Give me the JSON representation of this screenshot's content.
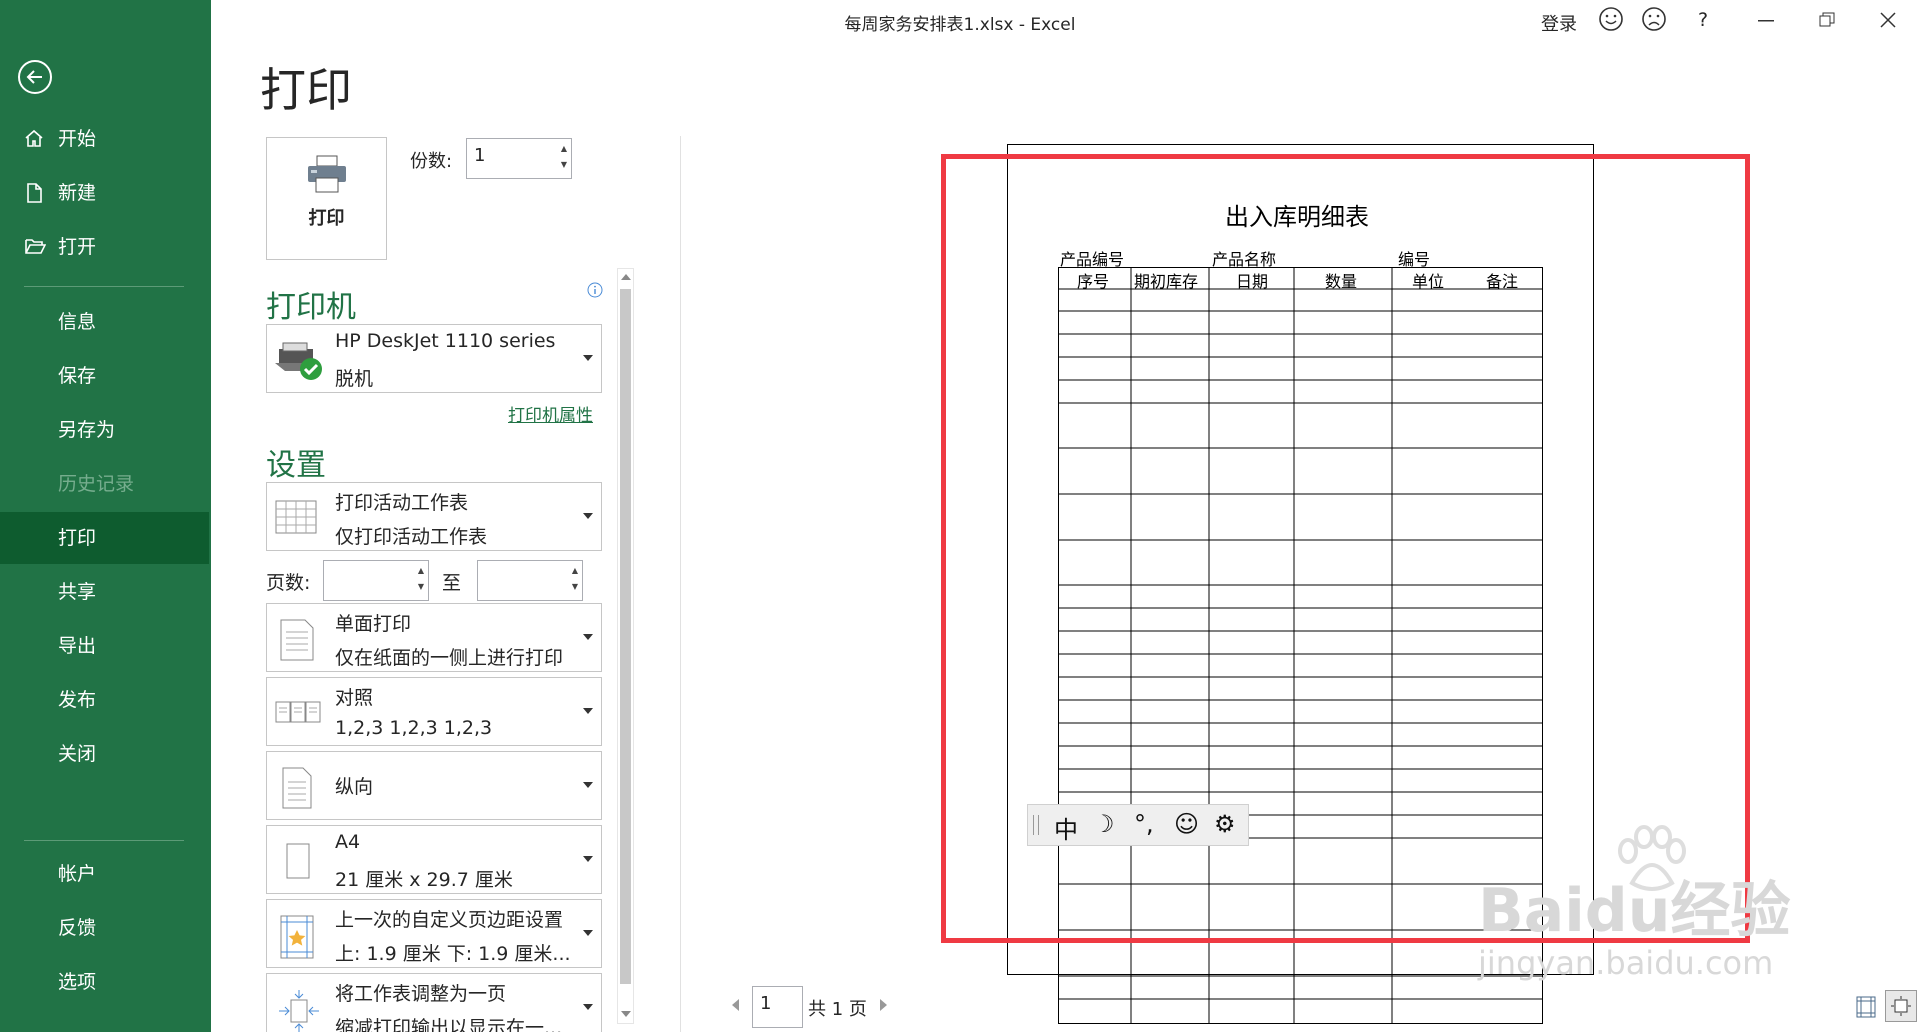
{
  "window": {
    "title": "每周家务安排表1.xlsx  -  Excel",
    "login": "登录",
    "help": "?"
  },
  "nav": {
    "items": [
      {
        "label": "开始"
      },
      {
        "label": "新建"
      },
      {
        "label": "打开"
      },
      {
        "label": "信息"
      },
      {
        "label": "保存"
      },
      {
        "label": "另存为"
      },
      {
        "label": "历史记录"
      },
      {
        "label": "打印"
      },
      {
        "label": "共享"
      },
      {
        "label": "导出"
      },
      {
        "label": "发布"
      },
      {
        "label": "关闭"
      },
      {
        "label": "帐户"
      },
      {
        "label": "反馈"
      },
      {
        "label": "选项"
      }
    ]
  },
  "page_title": "打印",
  "print_button": "打印",
  "copies": {
    "label": "份数:",
    "value": "1"
  },
  "printer": {
    "section": "打印机",
    "name": "HP DeskJet 1110 series",
    "status": "脱机",
    "properties_link": "打印机属性"
  },
  "settings": {
    "section": "设置",
    "scope": {
      "l1": "打印活动工作表",
      "l2": "仅打印活动工作表"
    },
    "pages": {
      "label": "页数:",
      "to": "至",
      "from_value": "",
      "to_value": ""
    },
    "sides": {
      "l1": "单面打印",
      "l2": "仅在纸面的一侧上进行打印"
    },
    "collate": {
      "l1": "对照",
      "l2": "1,2,3     1,2,3     1,2,3"
    },
    "orientation": {
      "l1": "纵向"
    },
    "paper": {
      "l1": "A4",
      "l2": "21 厘米 x 29.7 厘米"
    },
    "margins": {
      "l1": "上一次的自定义页边距设置",
      "l2": "上: 1.9 厘米 下: 1.9 厘米..."
    },
    "scaling": {
      "l1": "将工作表调整为一页",
      "l2": "缩减打印输出以显示在一..."
    }
  },
  "preview": {
    "sheet_title": "出入库明细表",
    "header_labels": [
      "产品编号",
      "产品名称",
      "编号"
    ],
    "columns": [
      "序号",
      "期初库存",
      "日期",
      "数量",
      "单位",
      "备注"
    ],
    "ime": [
      "中",
      "☽",
      "°,",
      "☺",
      "⚙"
    ]
  },
  "pager": {
    "current": "1",
    "total": "共 1 页"
  },
  "watermark": {
    "brand": "Baidu经验",
    "url": "jingyan.baidu.com"
  },
  "colors": {
    "excel_green": "#217346",
    "selected_nav": "#0e5c2f",
    "highlight": "#ef3a43"
  }
}
